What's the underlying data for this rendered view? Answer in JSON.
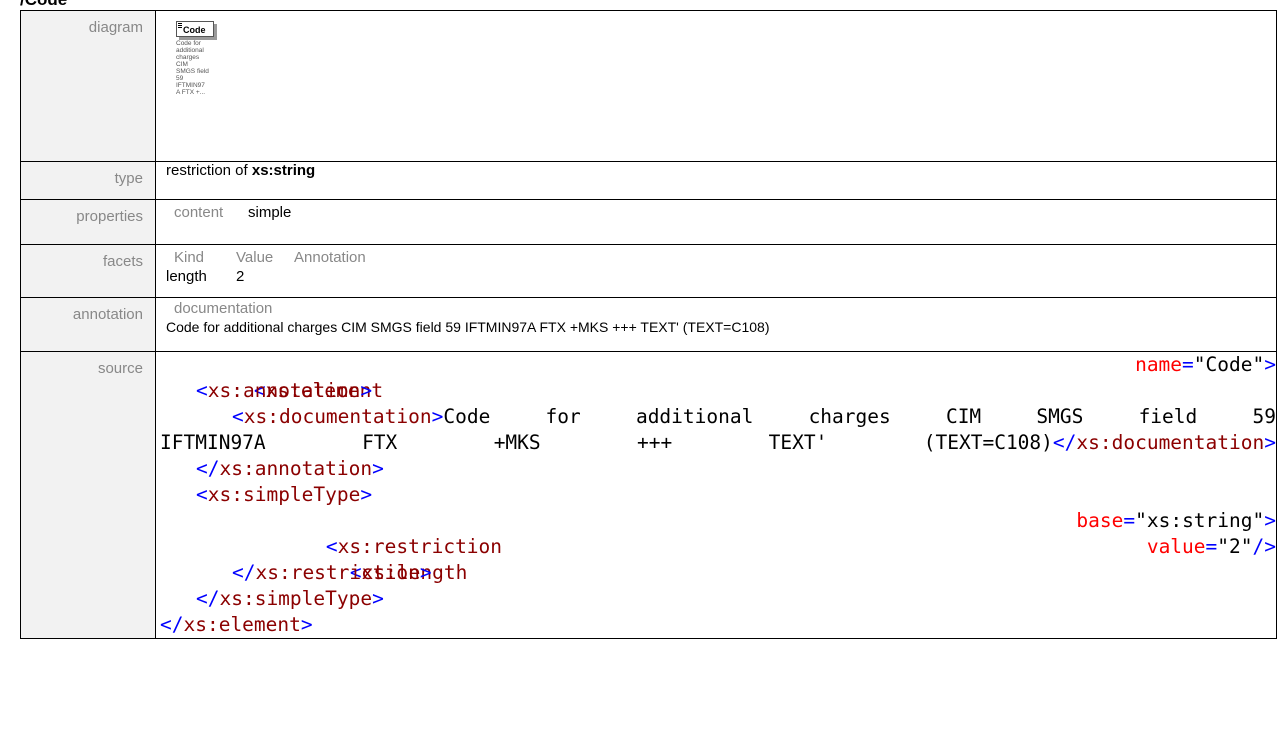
{
  "heading": "/Code",
  "rows": {
    "diagram": {
      "label": "diagram",
      "element_name": "Code",
      "doc_lines": [
        "Code for",
        "additional",
        "charges",
        "CIM",
        "SMGS field",
        "59",
        "IFTMIN97",
        "A FTX +..."
      ]
    },
    "type": {
      "label": "type",
      "prefix": "restriction of ",
      "base": "xs:string"
    },
    "properties": {
      "label": "properties",
      "key": "content",
      "value": "simple"
    },
    "facets": {
      "label": "facets",
      "headers": [
        "Kind",
        "Value",
        "Annotation"
      ],
      "rows": [
        {
          "kind": "length",
          "value": "2",
          "annotation": ""
        }
      ]
    },
    "annotation": {
      "label": "annotation",
      "head": "documentation",
      "text": "Code for additional charges CIM SMGS field 59 IFTMIN97A FTX +MKS +++ TEXT' (TEXT=C108)"
    },
    "source": {
      "label": "source",
      "element_open": "<xs:element",
      "name_attr": "name",
      "name_val": "\"Code\"",
      "annotation_open": "<xs:annotation>",
      "documentation_open": "<xs:documentation>",
      "doc_words_line1": [
        "Code",
        "for",
        "additional",
        "charges",
        "CIM",
        "SMGS",
        "field",
        "59"
      ],
      "doc_words_line2": [
        "IFTMIN97A",
        "FTX",
        "+MKS",
        "+++",
        "TEXT'",
        "(TEXT=C108)"
      ],
      "documentation_close": "</xs:documentation>",
      "annotation_close": "</xs:annotation>",
      "simpletype_open": "<xs:simpleType>",
      "restriction_open": "<xs:restriction",
      "base_attr": "base",
      "base_val": "\"xs:string\"",
      "length_open": "<xs:length",
      "value_attr": "value",
      "value_val": "\"2\"",
      "restriction_close": "</xs:restriction>",
      "simpletype_close": "</xs:simpleType>",
      "element_close": "</xs:element>"
    }
  }
}
